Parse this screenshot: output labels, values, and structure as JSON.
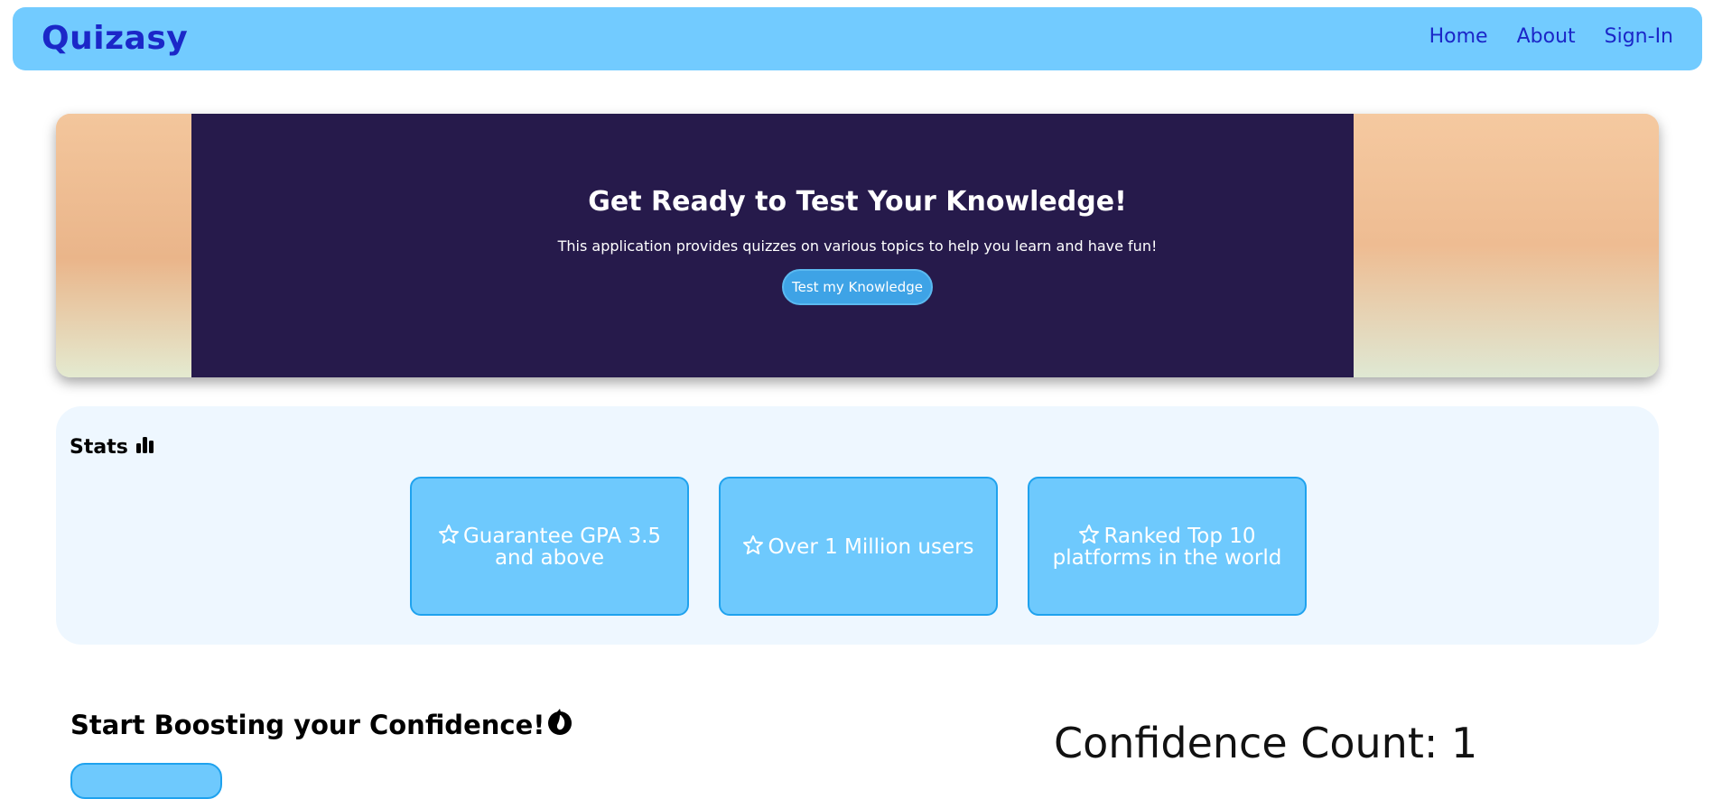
{
  "navbar": {
    "brand": "Quizasy",
    "links": [
      "Home",
      "About",
      "Sign-In"
    ]
  },
  "hero": {
    "title": "Get Ready to Test Your Knowledge!",
    "subtitle": "This application provides quizzes on various topics to help you learn and have fun!",
    "button_label": "Test my Knowledge"
  },
  "stats": {
    "heading": "Stats",
    "heading_icon": "bar-chart-icon",
    "cards": [
      {
        "icon": "star-icon",
        "text": "Guarantee GPA 3.5 and above"
      },
      {
        "icon": "star-icon",
        "text": "Over 1 Million users"
      },
      {
        "icon": "star-icon",
        "text": "Ranked Top 10 platforms in the world"
      }
    ]
  },
  "boost": {
    "heading": "Start Boosting your Confidence!",
    "heading_icon": "fire-icon"
  },
  "confidence": {
    "label": "Confidence Count: 1"
  },
  "colors": {
    "navbar_bg": "#72cbff",
    "brand": "#1b27c8",
    "hero_overlay": "#261a4b",
    "hero_button": "#3ea3e6",
    "stats_bg": "#eef7ff",
    "card_bg": "#6ec9fd",
    "card_border": "#1fa2ee"
  }
}
